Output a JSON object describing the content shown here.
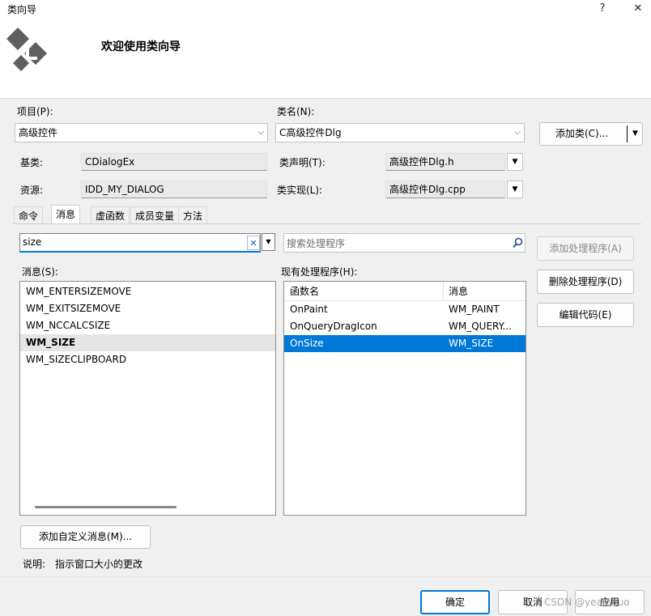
{
  "window": {
    "title": "类向导",
    "help_glyph": "?",
    "close_glyph": "✕"
  },
  "header": {
    "title": "欢迎使用类向导"
  },
  "project": {
    "label": "项目(P):",
    "value": "高级控件"
  },
  "classname": {
    "label": "类名(N):",
    "value": "C高级控件Dlg"
  },
  "add_class_button": {
    "label": "添加类(C)..."
  },
  "base_class": {
    "label": "基类:",
    "value": "CDialogEx"
  },
  "resource": {
    "label": "资源:",
    "value": "IDD_MY_DIALOG"
  },
  "class_decl": {
    "label": "类声明(T):",
    "value": "高级控件Dlg.h"
  },
  "class_impl": {
    "label": "类实现(L):",
    "value": "高级控件Dlg.cpp"
  },
  "tabs": [
    {
      "label": "命令"
    },
    {
      "label": "消息"
    },
    {
      "label": "虚函数"
    },
    {
      "label": "成员变量"
    },
    {
      "label": "方法"
    }
  ],
  "filter": {
    "value": "size",
    "clear_glyph": "✕",
    "dropdown_glyph": "▼"
  },
  "search": {
    "placeholder": "搜索处理程序"
  },
  "messages": {
    "label": "消息(S):",
    "items": [
      "WM_ENTERSIZEMOVE",
      "WM_EXITSIZEMOVE",
      "WM_NCCALCSIZE",
      "WM_SIZE",
      "WM_SIZECLIPBOARD"
    ],
    "selected": "WM_SIZE"
  },
  "handlers": {
    "label": "现有处理程序(H):",
    "columns": [
      "函数名",
      "消息"
    ],
    "rows": [
      [
        "OnPaint",
        "WM_PAINT"
      ],
      [
        "OnQueryDragIcon",
        "WM_QUERY..."
      ],
      [
        "OnSize",
        "WM_SIZE"
      ]
    ],
    "selected_row": 2
  },
  "side_buttons": {
    "add_handler": "添加处理程序(A)",
    "delete_handler": "删除处理程序(D)",
    "edit_code": "编辑代码(E)"
  },
  "add_custom_message": {
    "label": "添加自定义消息(M)..."
  },
  "description": {
    "label": "说明:",
    "text": "指示窗口大小的更改"
  },
  "footer": {
    "ok": "确定",
    "cancel": "取消",
    "apply": "应用",
    "watermark": "CSDN @yeaInhuo"
  },
  "colors": {
    "accent": "#0078d7",
    "selection_text": "#ffffff"
  }
}
